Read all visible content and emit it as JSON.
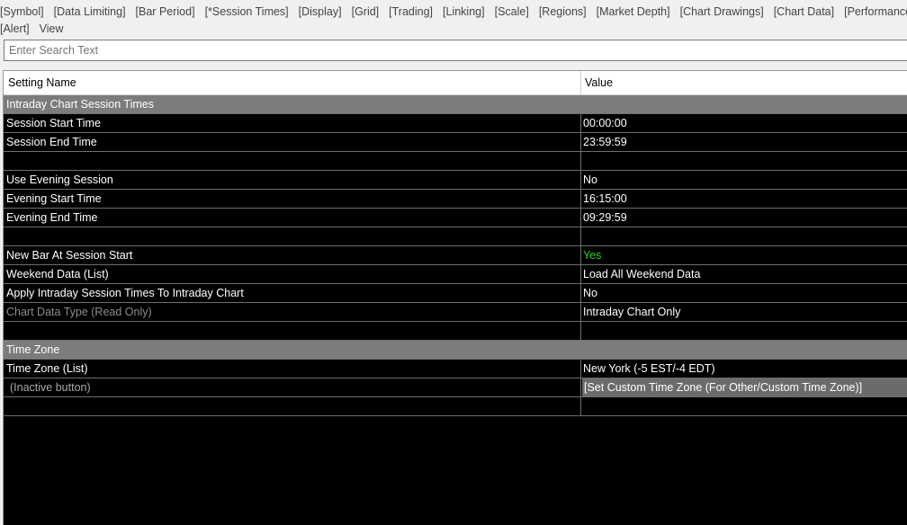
{
  "tabs_line1": [
    "[Symbol]",
    "[Data Limiting]",
    "[Bar Period]",
    "[*Session Times]",
    "[Display]",
    "[Grid]",
    "[Trading]",
    "[Linking]",
    "[Scale]",
    "[Regions]",
    "[Market Depth]",
    "[Chart Drawings]",
    "[Chart Data]",
    "[Performance]"
  ],
  "tabs_line2": [
    "[Alert]",
    "View"
  ],
  "search": {
    "placeholder": "Enter Search Text"
  },
  "header": {
    "name": "Setting Name",
    "value": "Value"
  },
  "rows": [
    {
      "type": "section",
      "name": "Intraday Chart Session Times"
    },
    {
      "type": "setting",
      "name": "Session Start Time",
      "value": "00:00:00"
    },
    {
      "type": "setting",
      "name": "Session End Time",
      "value": "23:59:59"
    },
    {
      "type": "blank"
    },
    {
      "type": "setting",
      "name": "Use Evening Session",
      "value": "No"
    },
    {
      "type": "setting",
      "name": "Evening Start Time",
      "value": "16:15:00"
    },
    {
      "type": "setting",
      "name": "Evening End Time",
      "value": "09:29:59"
    },
    {
      "type": "blank"
    },
    {
      "type": "setting",
      "name": "New Bar At Session Start",
      "value": "Yes",
      "value_color": "green"
    },
    {
      "type": "setting",
      "name": "Weekend Data (List)",
      "value": "Load All Weekend Data"
    },
    {
      "type": "setting",
      "name": "Apply Intraday Session Times To Intraday Chart",
      "value": "No"
    },
    {
      "type": "setting",
      "name": "Chart Data Type (Read Only)",
      "value": "Intraday Chart Only",
      "name_dim": true
    },
    {
      "type": "blank"
    },
    {
      "type": "section",
      "name": "Time Zone"
    },
    {
      "type": "setting",
      "name": "Time Zone (List)",
      "value": "New York (-5 EST/-4 EDT)"
    },
    {
      "type": "setting",
      "name": "(Inactive button)",
      "value": "[Set Custom Time Zone (For Other/Custom Time Zone)]",
      "name_indent": true,
      "value_button": true
    },
    {
      "type": "blank"
    }
  ],
  "colors": {
    "grid_bg": "#000000",
    "section_bg": "#7c7c7c",
    "yes_green": "#2fd12f"
  }
}
